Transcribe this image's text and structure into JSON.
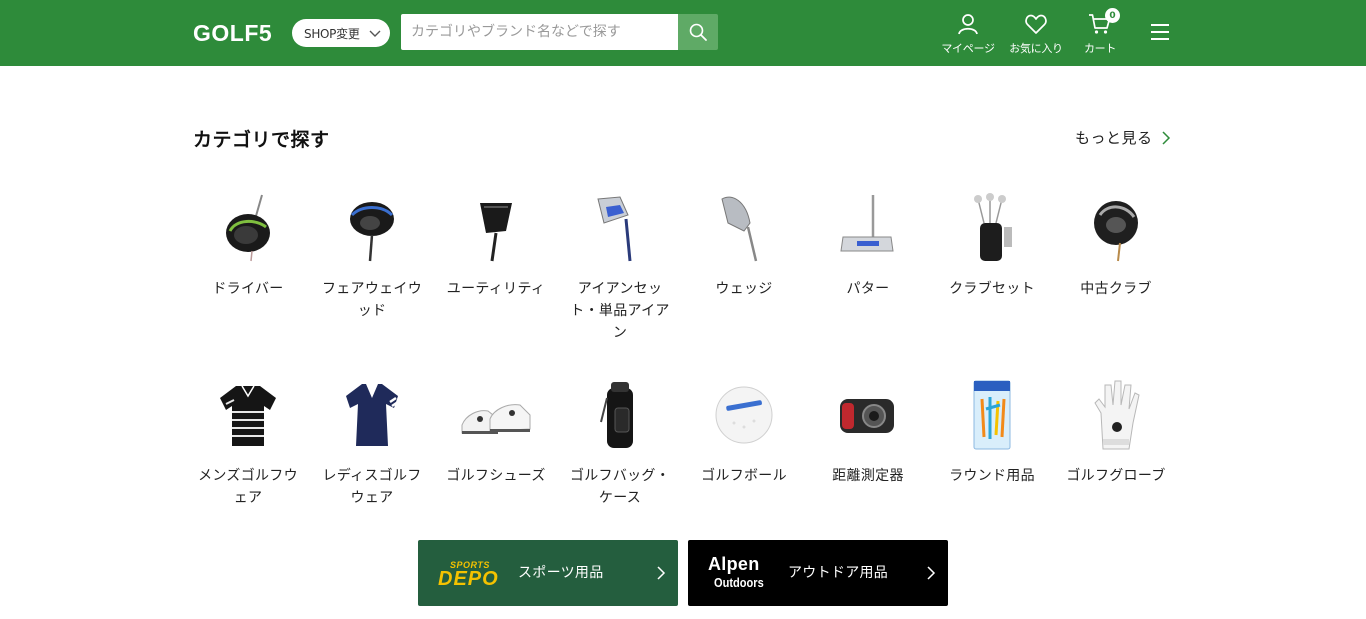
{
  "header": {
    "logo": "GOLF5",
    "shop_button_label": "SHOP変更",
    "search_placeholder": "カテゴリやブランド名などで探す",
    "nav": {
      "mypage": "マイページ",
      "favorites": "お気に入り",
      "cart": "カート",
      "cart_count": "0"
    },
    "colors": {
      "header_bg": "#2e8b3a",
      "search_button_bg": "#5faa66"
    }
  },
  "section": {
    "title": "カテゴリで探す",
    "more_link": "もっと見る"
  },
  "categories_row1": [
    {
      "label": "ドライバー",
      "icon": "driver-club-icon"
    },
    {
      "label": "フェアウェイウッド",
      "icon": "fairway-wood-icon"
    },
    {
      "label": "ユーティリティ",
      "icon": "utility-club-icon"
    },
    {
      "label": "アイアンセット・単品アイアン",
      "icon": "iron-club-icon"
    },
    {
      "label": "ウェッジ",
      "icon": "wedge-club-icon"
    },
    {
      "label": "パター",
      "icon": "putter-icon"
    },
    {
      "label": "クラブセット",
      "icon": "club-set-icon"
    },
    {
      "label": "中古クラブ",
      "icon": "used-club-icon"
    }
  ],
  "categories_row2": [
    {
      "label": "メンズゴルフウェア",
      "icon": "mens-polo-icon"
    },
    {
      "label": "レディスゴルフウェア",
      "icon": "ladies-polo-icon"
    },
    {
      "label": "ゴルフシューズ",
      "icon": "golf-shoes-icon"
    },
    {
      "label": "ゴルフバッグ・ケース",
      "icon": "golf-bag-icon"
    },
    {
      "label": "ゴルフボール",
      "icon": "golf-ball-icon"
    },
    {
      "label": "距離測定器",
      "icon": "rangefinder-icon"
    },
    {
      "label": "ラウンド用品",
      "icon": "golf-tees-icon"
    },
    {
      "label": "ゴルフグローブ",
      "icon": "golf-glove-icon"
    }
  ],
  "banners": {
    "depo": {
      "logo_top": "SPORTS",
      "logo_main": "DEPO",
      "label": "スポーツ用品",
      "bg": "#245e3e",
      "logo_color": "#f4c200"
    },
    "alpen": {
      "logo_top": "Alpen",
      "logo_sub": "Outdoors",
      "label": "アウトドア用品",
      "bg": "#000000"
    }
  }
}
